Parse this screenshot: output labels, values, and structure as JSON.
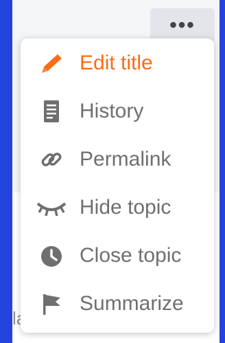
{
  "more_button": {
    "label": "•••",
    "icon": "more-horizontal-icon"
  },
  "menu": {
    "accent_color": "#fa6c17",
    "text_color": "#6f6f6f",
    "items": [
      {
        "label": "Edit title",
        "icon": "pencil-icon",
        "active": true
      },
      {
        "label": "History",
        "icon": "document-icon",
        "active": false
      },
      {
        "label": "Permalink",
        "icon": "link-icon",
        "active": false
      },
      {
        "label": "Hide topic",
        "icon": "eye-closed-icon",
        "active": false
      },
      {
        "label": "Close topic",
        "icon": "clock-icon",
        "active": false
      },
      {
        "label": "Summarize",
        "icon": "flag-icon",
        "active": false
      }
    ]
  },
  "background_peek_text": "la"
}
